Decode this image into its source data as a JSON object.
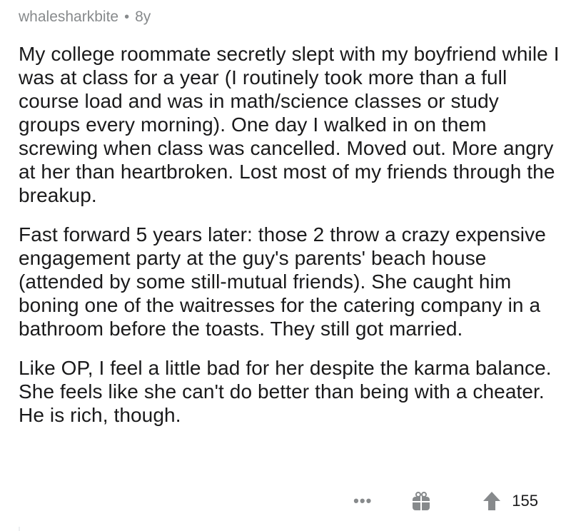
{
  "comment": {
    "author": "whalesharkbite",
    "separator": "•",
    "age": "8y",
    "paragraphs": [
      "My college roommate secretly slept with my boyfriend while I was at class for a year (I routinely took more than a full course load and was in math/science classes or study groups every morning). One day I walked in on them screwing when class was cancelled. Moved out. More angry at her than heartbroken. Lost most of my friends through the breakup.",
      "Fast forward 5 years later: those 2 throw a crazy expensive engagement party at the guy's parents' beach house (attended by some still-mutual friends). She caught him boning one of the waitresses for the catering company in a bathroom before the toasts. They still got married.",
      "Like OP, I feel a little bad for her despite the karma balance. She feels like she can't do better than being with a cheater. He is rich, though."
    ],
    "actions": {
      "more_label": "•••",
      "gift_icon": "gift-icon",
      "upvote_icon": "upvote-icon",
      "score": "155"
    }
  },
  "colors": {
    "text": "#1a1a1b",
    "meta": "#878a8c",
    "icon": "#878a8c"
  }
}
